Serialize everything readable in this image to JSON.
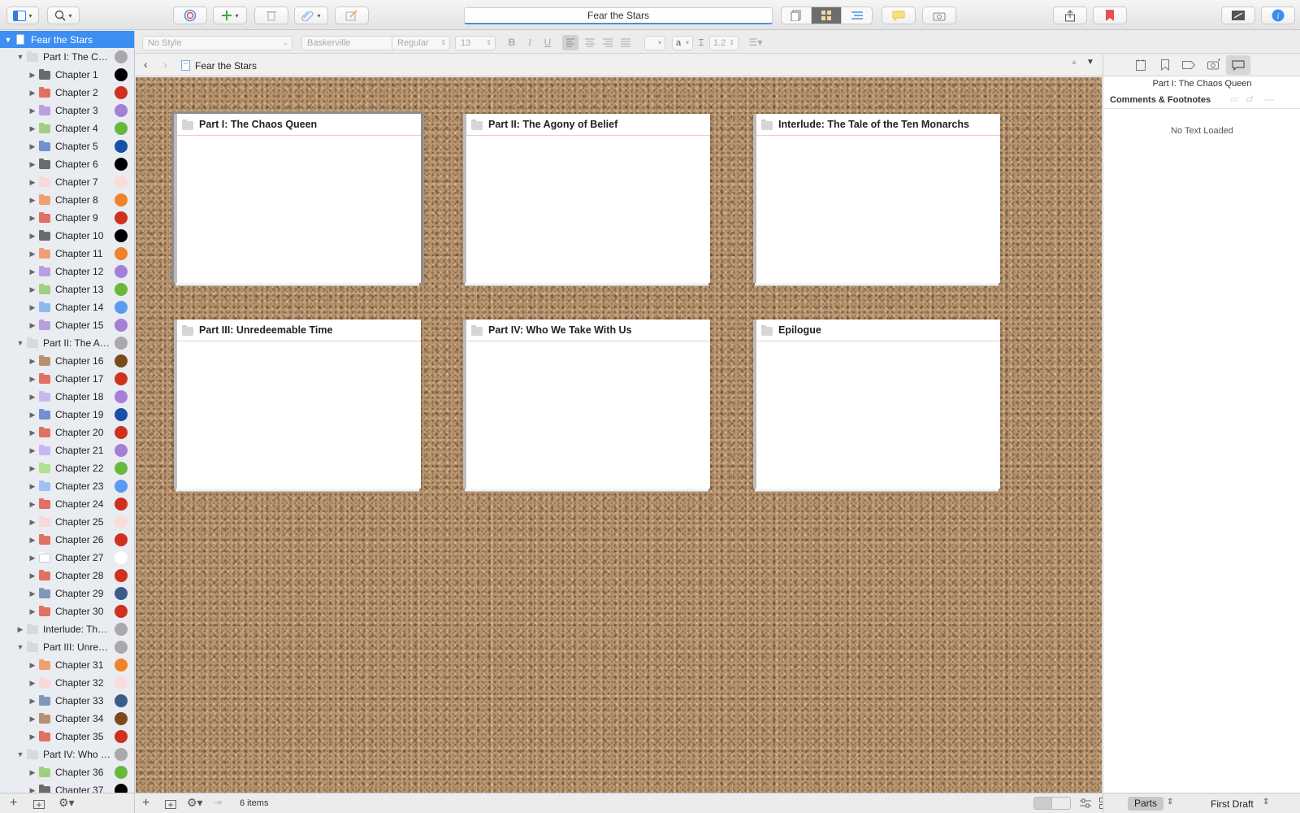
{
  "toolbar": {
    "document_title": "Fear the Stars"
  },
  "format_bar": {
    "style": "No Style",
    "font": "Baskerville",
    "weight": "Regular",
    "size": "13",
    "bold": "B",
    "italic": "I",
    "underline": "U",
    "text_color_label": "a",
    "line_spacing": "1.2"
  },
  "binder": {
    "items": [
      {
        "label": "Fear the Stars",
        "level": 0,
        "expanded": true,
        "type": "doc",
        "selected": true,
        "color": null
      },
      {
        "label": "Part I: The Chaos Queen",
        "level": 1,
        "expanded": true,
        "type": "folder",
        "folder_color": "#d9d9d9",
        "color": "#a9a9a9"
      },
      {
        "label": "Chapter 1",
        "level": 2,
        "type": "folder",
        "folder_color": "#6b6b6b",
        "color": "#000000"
      },
      {
        "label": "Chapter 2",
        "level": 2,
        "type": "folder",
        "folder_color": "#e07060",
        "color": "#d0301e"
      },
      {
        "label": "Chapter 3",
        "level": 2,
        "type": "folder",
        "folder_color": "#b8a0e0",
        "color": "#a57fd6"
      },
      {
        "label": "Chapter 4",
        "level": 2,
        "type": "folder",
        "folder_color": "#9fd080",
        "color": "#6ab83a"
      },
      {
        "label": "Chapter 5",
        "level": 2,
        "type": "folder",
        "folder_color": "#7090d0",
        "color": "#1a4fa6"
      },
      {
        "label": "Chapter 6",
        "level": 2,
        "type": "folder",
        "folder_color": "#6b6b6b",
        "color": "#000000"
      },
      {
        "label": "Chapter 7",
        "level": 2,
        "type": "folder",
        "folder_color": "#f8d8d8",
        "color": "#fadcdc"
      },
      {
        "label": "Chapter 8",
        "level": 2,
        "type": "folder",
        "folder_color": "#f0a070",
        "color": "#f0822a"
      },
      {
        "label": "Chapter 9",
        "level": 2,
        "type": "folder",
        "folder_color": "#e07060",
        "color": "#d0301e"
      },
      {
        "label": "Chapter 10",
        "level": 2,
        "type": "folder",
        "folder_color": "#6b6b6b",
        "color": "#000000"
      },
      {
        "label": "Chapter 11",
        "level": 2,
        "type": "folder",
        "folder_color": "#f0a070",
        "color": "#f0822a"
      },
      {
        "label": "Chapter 12",
        "level": 2,
        "type": "folder",
        "folder_color": "#b8a0e0",
        "color": "#a57fd6"
      },
      {
        "label": "Chapter 13",
        "level": 2,
        "type": "folder",
        "folder_color": "#9fd080",
        "color": "#6ab83a"
      },
      {
        "label": "Chapter 14",
        "level": 2,
        "type": "folder",
        "folder_color": "#90b8f0",
        "color": "#5b9af0"
      },
      {
        "label": "Chapter 15",
        "level": 2,
        "type": "folder",
        "folder_color": "#b8a0e0",
        "color": "#a57fd6"
      },
      {
        "label": "Part II: The Agony of Belief",
        "level": 1,
        "expanded": true,
        "type": "folder",
        "folder_color": "#d9d9d9",
        "color": "#a9a9a9"
      },
      {
        "label": "Chapter 16",
        "level": 2,
        "type": "folder",
        "folder_color": "#b89070",
        "color": "#7a4a1e"
      },
      {
        "label": "Chapter 17",
        "level": 2,
        "type": "folder",
        "folder_color": "#e07060",
        "color": "#d0301e"
      },
      {
        "label": "Chapter 18",
        "level": 2,
        "type": "folder",
        "folder_color": "#c8b8f0",
        "color": "#a57fd6"
      },
      {
        "label": "Chapter 19",
        "level": 2,
        "type": "folder",
        "folder_color": "#7090d0",
        "color": "#1a4fa6"
      },
      {
        "label": "Chapter 20",
        "level": 2,
        "type": "folder",
        "folder_color": "#e07060",
        "color": "#d0301e"
      },
      {
        "label": "Chapter 21",
        "level": 2,
        "type": "folder",
        "folder_color": "#c8b8f0",
        "color": "#a57fd6"
      },
      {
        "label": "Chapter 22",
        "level": 2,
        "type": "folder",
        "folder_color": "#b0e090",
        "color": "#6ab83a"
      },
      {
        "label": "Chapter 23",
        "level": 2,
        "type": "folder",
        "folder_color": "#a0c0f8",
        "color": "#5b9af0"
      },
      {
        "label": "Chapter 24",
        "level": 2,
        "type": "folder",
        "folder_color": "#e07060",
        "color": "#d0301e"
      },
      {
        "label": "Chapter 25",
        "level": 2,
        "type": "folder",
        "folder_color": "#f8d8d8",
        "color": "#fadcdc"
      },
      {
        "label": "Chapter 26",
        "level": 2,
        "type": "folder",
        "folder_color": "#e07060",
        "color": "#d0301e"
      },
      {
        "label": "Chapter 27",
        "level": 2,
        "type": "folder",
        "folder_color": "#ffffff",
        "color": "#ffffff"
      },
      {
        "label": "Chapter 28",
        "level": 2,
        "type": "folder",
        "folder_color": "#e07060",
        "color": "#d0301e"
      },
      {
        "label": "Chapter 29",
        "level": 2,
        "type": "folder",
        "folder_color": "#8098b8",
        "color": "#3a5a8a"
      },
      {
        "label": "Chapter 30",
        "level": 2,
        "type": "folder",
        "folder_color": "#e07060",
        "color": "#d0301e"
      },
      {
        "label": "Interlude: The Tale of the Ten Monarchs",
        "level": 1,
        "expanded": false,
        "type": "folder",
        "folder_color": "#d9d9d9",
        "color": "#a9a9a9"
      },
      {
        "label": "Part III: Unredeemable Time",
        "level": 1,
        "expanded": true,
        "type": "folder",
        "folder_color": "#d9d9d9",
        "color": "#a9a9a9"
      },
      {
        "label": "Chapter 31",
        "level": 2,
        "type": "folder",
        "folder_color": "#f0a070",
        "color": "#f0822a"
      },
      {
        "label": "Chapter 32",
        "level": 2,
        "type": "folder",
        "folder_color": "#f8d8d8",
        "color": "#fadcdc"
      },
      {
        "label": "Chapter 33",
        "level": 2,
        "type": "folder",
        "folder_color": "#8098b8",
        "color": "#3a5a8a"
      },
      {
        "label": "Chapter 34",
        "level": 2,
        "type": "folder",
        "folder_color": "#b89070",
        "color": "#7a4a1e"
      },
      {
        "label": "Chapter 35",
        "level": 2,
        "type": "folder",
        "folder_color": "#e07060",
        "color": "#d0301e"
      },
      {
        "label": "Part IV: Who We Take With Us",
        "level": 1,
        "expanded": true,
        "type": "folder",
        "folder_color": "#d9d9d9",
        "color": "#a9a9a9"
      },
      {
        "label": "Chapter 36",
        "level": 2,
        "type": "folder",
        "folder_color": "#9fd080",
        "color": "#6ab83a"
      },
      {
        "label": "Chapter 37",
        "level": 2,
        "type": "folder",
        "folder_color": "#6b6b6b",
        "color": "#000000"
      }
    ]
  },
  "pathbar": {
    "title": "Fear the Stars"
  },
  "corkboard": {
    "cards": [
      {
        "title": "Part I: The Chaos Queen",
        "selected": true
      },
      {
        "title": "Part II: The Agony of Belief",
        "selected": false
      },
      {
        "title": "Interlude: The Tale of the Ten Monarchs",
        "selected": false
      },
      {
        "title": "Part III: Unredeemable Time",
        "selected": false
      },
      {
        "title": "Part IV: Who We Take With Us",
        "selected": false
      },
      {
        "title": "Epilogue",
        "selected": false
      }
    ]
  },
  "editor_footer": {
    "item_count": "6 items"
  },
  "inspector": {
    "doc_title": "Part I: The Chaos Queen",
    "section_title": "Comments & Footnotes",
    "empty_message": "No Text Loaded"
  },
  "inspector_footer": {
    "collection": "Parts",
    "status": "First Draft"
  },
  "colors": {
    "accent": "#3c8ef3",
    "cork": "#b89570"
  }
}
